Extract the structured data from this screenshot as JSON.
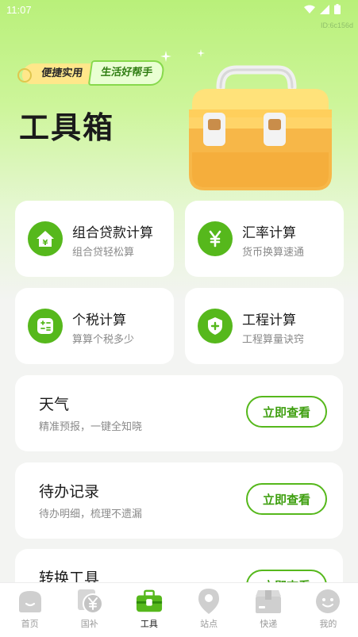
{
  "status": {
    "time": "11:07",
    "page_id": "ID:6c156d"
  },
  "hero": {
    "tag_left": "便捷实用",
    "tag_right": "生活好帮手",
    "title": "工具箱"
  },
  "tools": [
    {
      "title": "组合贷款计算",
      "subtitle": "组合贷轻松算",
      "icon": "house-yen-icon"
    },
    {
      "title": "汇率计算",
      "subtitle": "货币换算速通",
      "icon": "yen-icon"
    },
    {
      "title": "个税计算",
      "subtitle": "算算个税多少",
      "icon": "calculator-icon"
    },
    {
      "title": "工程计算",
      "subtitle": "工程算量诀窍",
      "icon": "shield-plus-icon"
    }
  ],
  "features": [
    {
      "title": "天气",
      "subtitle": "精准预报，一键全知晓",
      "button": "立即查看"
    },
    {
      "title": "待办记录",
      "subtitle": "待办明细，梳理不遗漏",
      "button": "立即查看"
    },
    {
      "title": "转换工具",
      "subtitle": "",
      "button": "立即查看"
    }
  ],
  "tabbar": [
    {
      "label": "首页",
      "icon": "home-icon",
      "active": false
    },
    {
      "label": "国补",
      "icon": "yen-coin-icon",
      "active": false
    },
    {
      "label": "工具",
      "icon": "toolbox-icon",
      "active": true
    },
    {
      "label": "站点",
      "icon": "location-pin-icon",
      "active": false
    },
    {
      "label": "快递",
      "icon": "package-icon",
      "active": false
    },
    {
      "label": "我的",
      "icon": "profile-icon",
      "active": false
    }
  ],
  "colors": {
    "accent": "#56b81c",
    "hero_green": "#b9f07a",
    "tag_yellow": "#ffe78a",
    "toolbox_orange": "#f7b748"
  }
}
